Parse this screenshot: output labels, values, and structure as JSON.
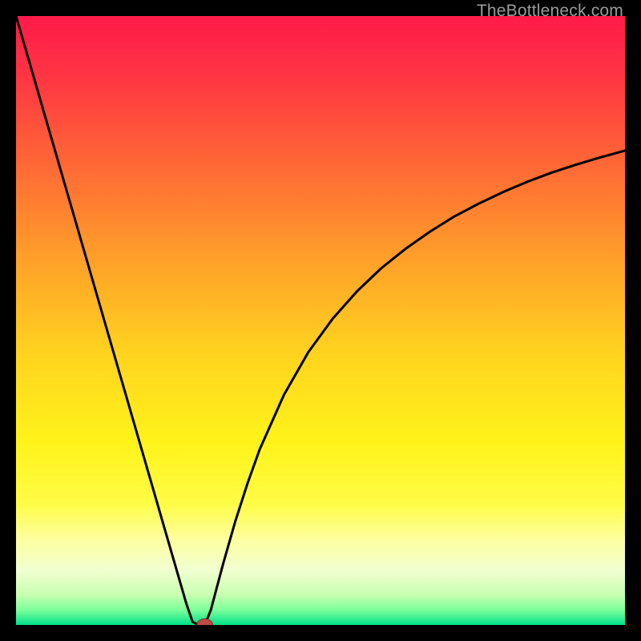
{
  "watermark": {
    "text": "TheBottleneck.com"
  },
  "colors": {
    "bg": "#000000",
    "curve": "#000000",
    "dot_fill": "#c24a44",
    "dot_stroke": "#7a2f2a"
  },
  "chart_data": {
    "type": "line",
    "title": "",
    "xlabel": "",
    "ylabel": "",
    "xlim": [
      0,
      100
    ],
    "ylim": [
      0,
      100
    ],
    "gradient_stops": [
      {
        "offset": 0.0,
        "color": "#ff1a49"
      },
      {
        "offset": 0.1,
        "color": "#ff3543"
      },
      {
        "offset": 0.25,
        "color": "#ff6a35"
      },
      {
        "offset": 0.4,
        "color": "#ffa029"
      },
      {
        "offset": 0.55,
        "color": "#ffd21f"
      },
      {
        "offset": 0.7,
        "color": "#fff31a"
      },
      {
        "offset": 0.8,
        "color": "#fffc45"
      },
      {
        "offset": 0.86,
        "color": "#fdffa0"
      },
      {
        "offset": 0.91,
        "color": "#f2ffd0"
      },
      {
        "offset": 0.95,
        "color": "#c8ffb0"
      },
      {
        "offset": 0.975,
        "color": "#7dff9a"
      },
      {
        "offset": 1.0,
        "color": "#00e08a"
      }
    ],
    "series": [
      {
        "name": "bottleneck-curve",
        "x": [
          0,
          2,
          4,
          6,
          8,
          10,
          12,
          14,
          16,
          18,
          20,
          22,
          24,
          26,
          28,
          29,
          30,
          31,
          32,
          34,
          36,
          38,
          40,
          44,
          48,
          52,
          56,
          60,
          64,
          68,
          72,
          76,
          80,
          84,
          88,
          92,
          96,
          100
        ],
        "y": [
          100,
          93.1,
          86.2,
          79.3,
          72.4,
          65.5,
          58.6,
          51.7,
          44.8,
          37.9,
          31.0,
          24.1,
          17.2,
          10.3,
          3.4,
          0.5,
          0.0,
          0.0,
          2.5,
          10.0,
          17.0,
          23.2,
          28.8,
          37.8,
          44.8,
          50.3,
          54.8,
          58.6,
          61.8,
          64.6,
          67.1,
          69.2,
          71.1,
          72.8,
          74.3,
          75.6,
          76.8,
          77.9
        ]
      }
    ],
    "marker": {
      "x": 31,
      "y": 0,
      "rx": 1.3,
      "ry": 1.0
    }
  }
}
